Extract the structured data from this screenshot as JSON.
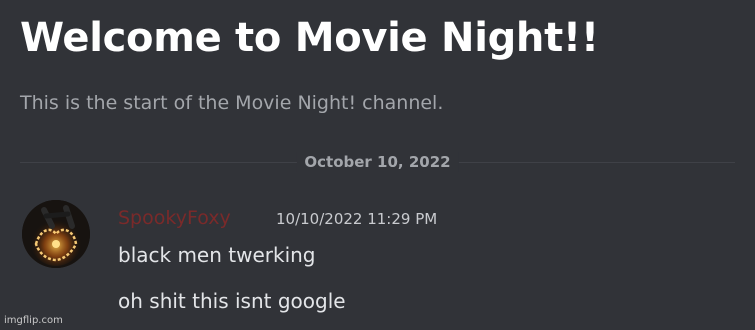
{
  "channel": {
    "welcome_title": "Welcome to Movie Night!!",
    "welcome_subtitle": "This is the start of the Movie Night! channel."
  },
  "divider": {
    "date": "October 10, 2022"
  },
  "message": {
    "username": "SpookyFoxy",
    "username_color": "#7a2a2a",
    "timestamp": "10/10/2022 11:29 PM",
    "avatar_icon": "fox-avatar",
    "lines": [
      "black men twerking",
      "oh shit this isnt google"
    ]
  },
  "watermark": "imgflip.com",
  "colors": {
    "background": "#313338",
    "title": "#ffffff",
    "muted_text": "#a3a6ab",
    "message_text": "#e3e5e8"
  }
}
